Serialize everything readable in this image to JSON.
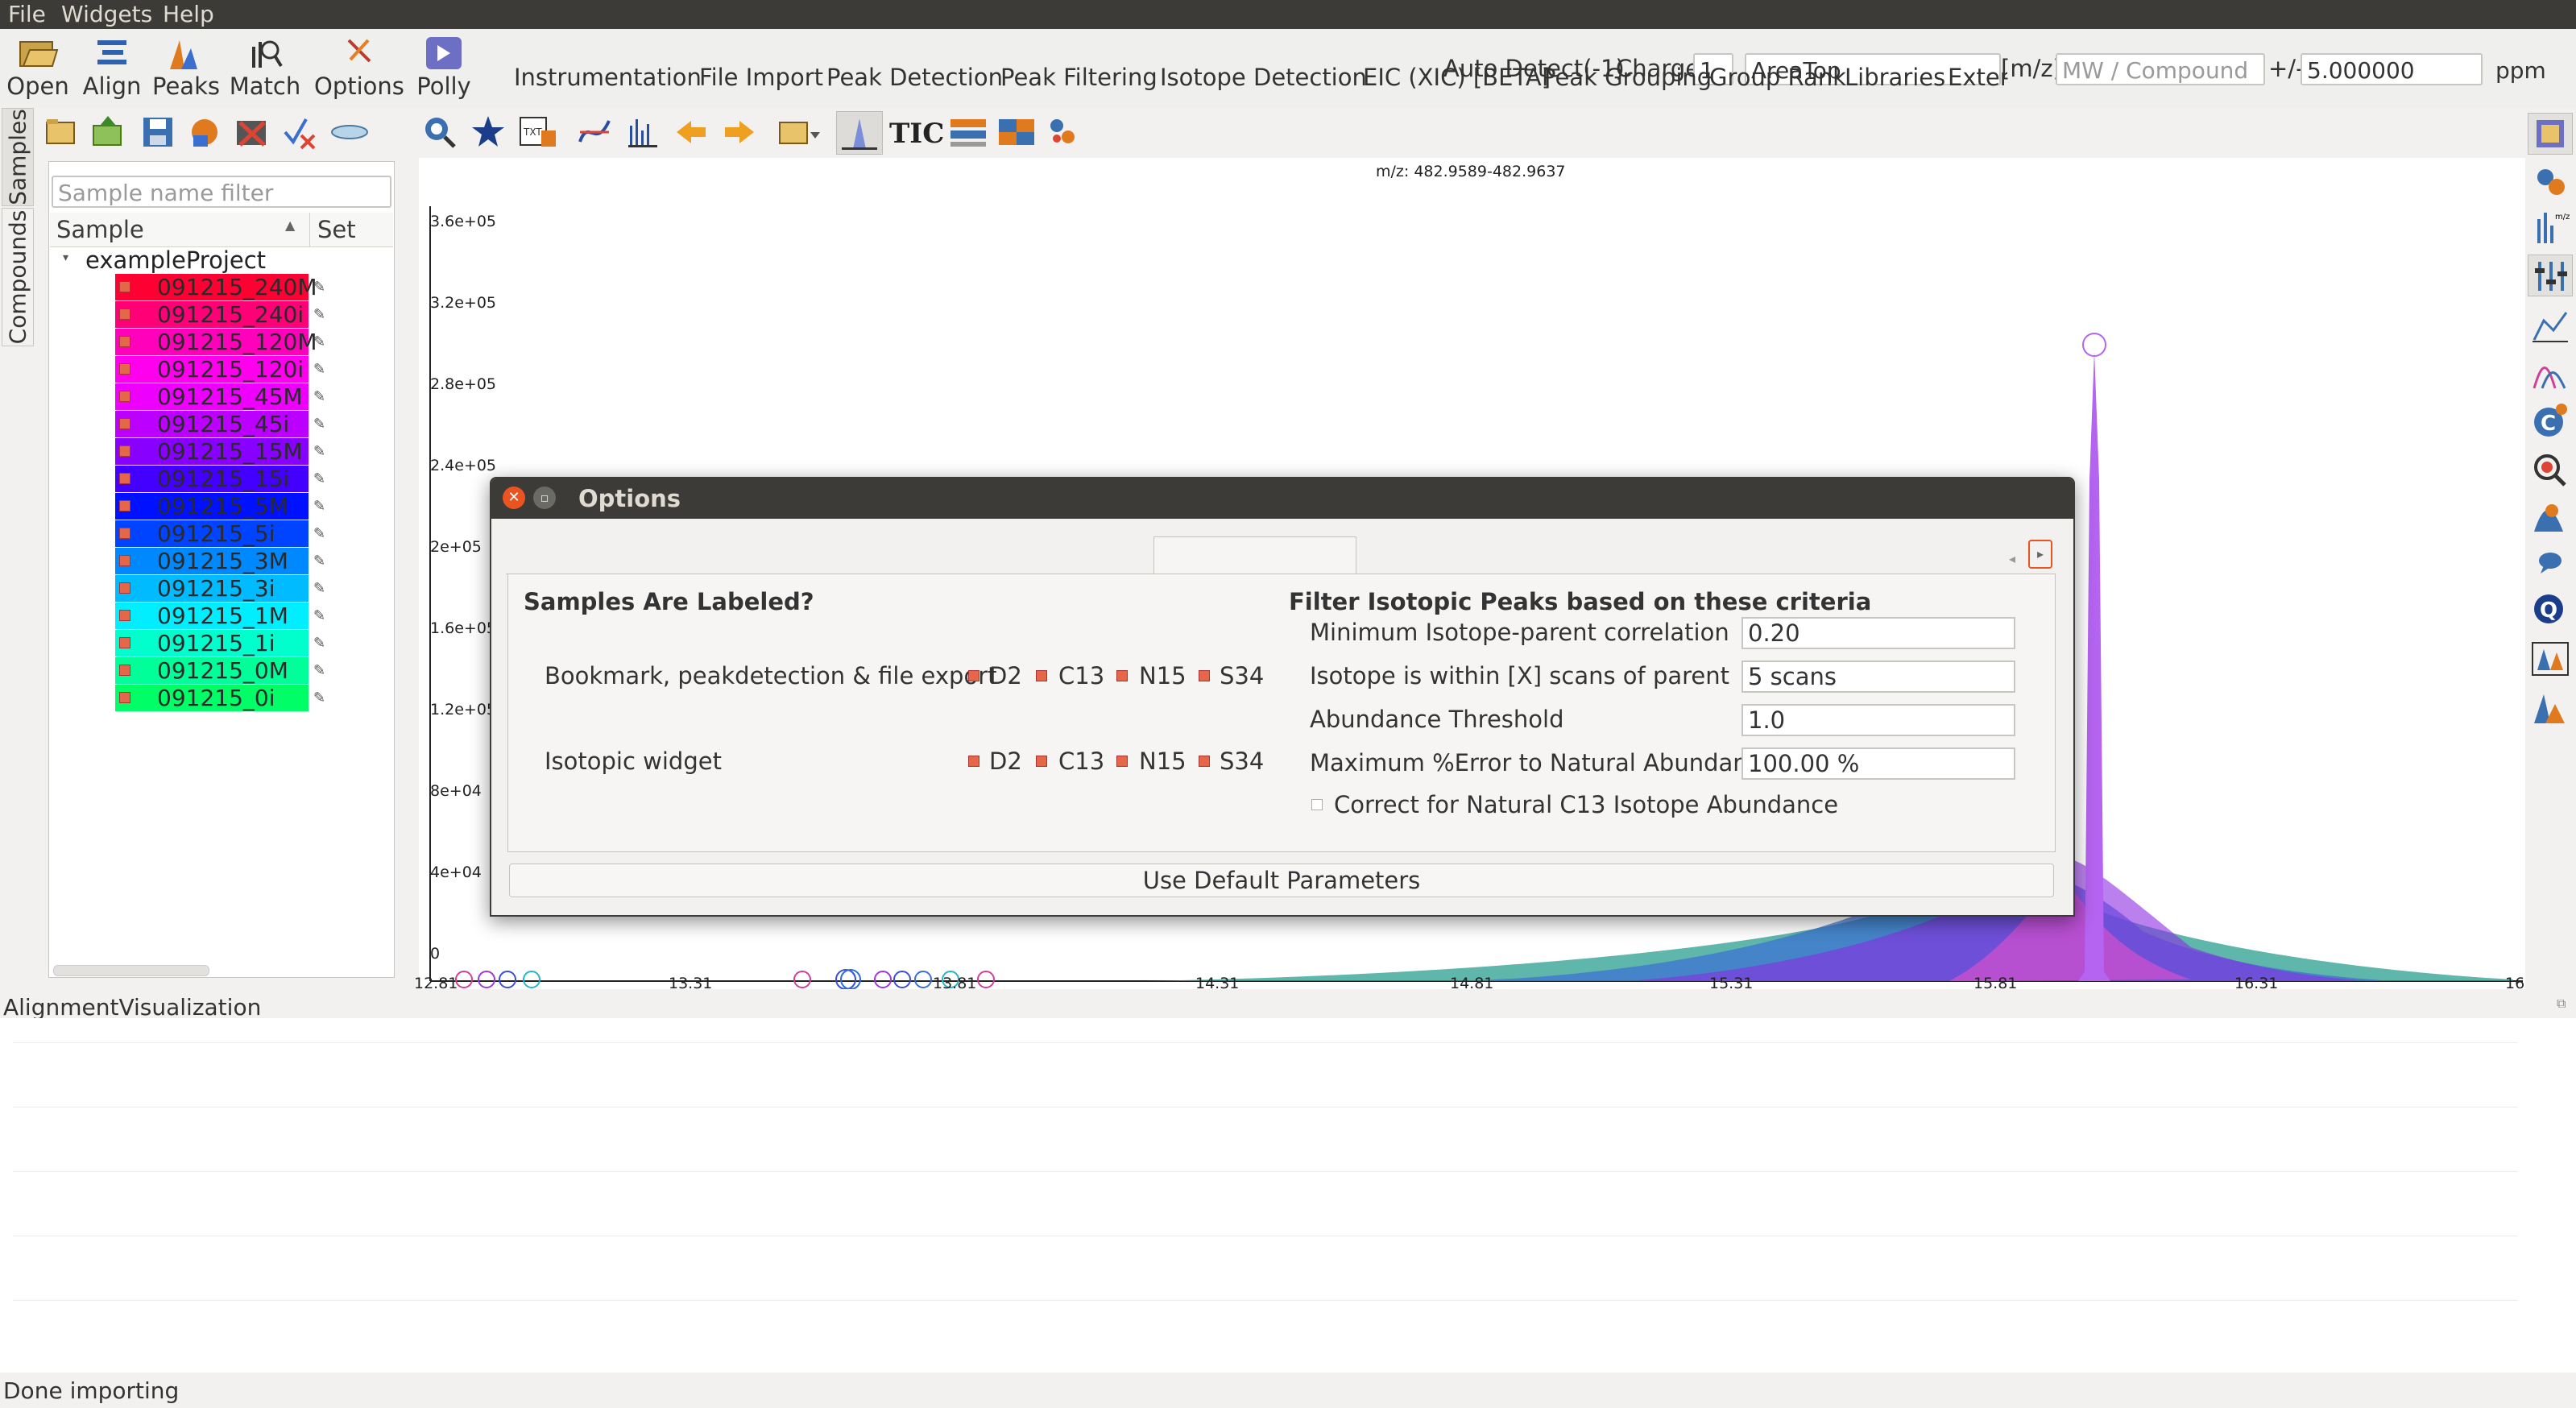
{
  "menubar": {
    "file": "File",
    "widgets": "Widgets",
    "help": "Help"
  },
  "toolbar": {
    "open": "Open",
    "align": "Align",
    "peaks": "Peaks",
    "match": "Match",
    "options": "Options",
    "polly": "Polly",
    "auto_detect": "Auto Detect(-1)",
    "charge_label": "Charge",
    "charge_value": "1",
    "area_mode": "AreaTop",
    "mz_label": "[m/z]",
    "mz_placeholder": "MW / Compound",
    "pm_label": "+/-",
    "tolerance": "5.000000",
    "unit": "ppm"
  },
  "side_tabs": {
    "samples": "Samples",
    "compounds": "Compounds"
  },
  "samples_panel": {
    "filter_placeholder": "Sample name filter",
    "col_sample": "Sample",
    "col_set": "Set",
    "project": "exampleProject",
    "samples": [
      {
        "name": "091215_240M",
        "color": "#ff0033"
      },
      {
        "name": "091215_240i",
        "color": "#ff0077"
      },
      {
        "name": "091215_120M",
        "color": "#ff00bb"
      },
      {
        "name": "091215_120i",
        "color": "#ff00ee"
      },
      {
        "name": "091215_45M",
        "color": "#ee00ff"
      },
      {
        "name": "091215_45i",
        "color": "#bb00ff"
      },
      {
        "name": "091215_15M",
        "color": "#8800ff"
      },
      {
        "name": "091215_15i",
        "color": "#4400ff"
      },
      {
        "name": "091215_5M",
        "color": "#0011ff"
      },
      {
        "name": "091215_5i",
        "color": "#0044ff"
      },
      {
        "name": "091215_3M",
        "color": "#0088ff"
      },
      {
        "name": "091215_3i",
        "color": "#00bbff"
      },
      {
        "name": "091215_1M",
        "color": "#00eeff"
      },
      {
        "name": "091215_1i",
        "color": "#00ffcc"
      },
      {
        "name": "091215_0M",
        "color": "#00ff99"
      },
      {
        "name": "091215_0i",
        "color": "#00ff66"
      }
    ]
  },
  "plot": {
    "title": "m/z: 482.9589-482.9637",
    "y_ticks": [
      "3.6e+05",
      "3.2e+05",
      "2.8e+05",
      "2.4e+05",
      "2e+05",
      "1.6e+05",
      "1.2e+05",
      "8e+04",
      "4e+04",
      "0"
    ],
    "x_ticks": [
      "12.81",
      "13.31",
      "13.81",
      "14.31",
      "14.81",
      "15.31",
      "15.81",
      "16.31",
      "16"
    ]
  },
  "options_dialog": {
    "title": "Options",
    "tabs": [
      "Instrumentation",
      "File Import",
      "Peak Detection",
      "Peak Filtering",
      "Isotope Detection",
      "EIC (XIC) [BETA]",
      "Peak Grouping",
      "Group Rank",
      "Libraries",
      "Exter"
    ],
    "active_tab": "Isotope Detection",
    "labeled_heading": "Samples Are Labeled?",
    "row1_label": "Bookmark, peakdetection & file export",
    "row2_label": "Isotopic widget",
    "isotopes": [
      "D2",
      "C13",
      "N15",
      "S34"
    ],
    "filter_heading": "Filter Isotopic Peaks based on these criteria",
    "min_corr_label": "Minimum Isotope-parent correlation",
    "min_corr_value": "0.20",
    "scans_label": "Isotope is within [X] scans of parent",
    "scans_value": "5 scans",
    "abundance_label": "Abundance Threshold",
    "abundance_value": "1.0",
    "max_error_label": "Maximum %Error to Natural Abundance",
    "max_error_value": "100.00 %",
    "correct_c13_label": "Correct for Natural C13 Isotope Abundance",
    "default_button": "Use Default Parameters"
  },
  "alignment": {
    "title": "AlignmentVisualization"
  },
  "status": {
    "text": "Done importing"
  }
}
